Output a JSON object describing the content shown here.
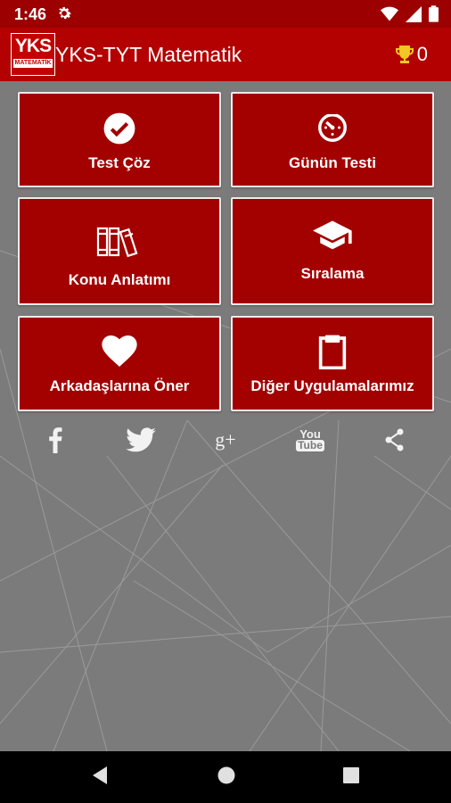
{
  "status_bar": {
    "time": "1:46",
    "icons": [
      "gear-icon",
      "wifi-icon",
      "signal-icon",
      "battery-icon"
    ]
  },
  "app_bar": {
    "logo": {
      "text": "YKS",
      "subtext": "MATEMATİK"
    },
    "title": "YKS-TYT Matematik",
    "trophy_count": "0"
  },
  "tiles": [
    {
      "label": "Test Çöz",
      "icon": "check-circle-icon"
    },
    {
      "label": "Günün Testi",
      "icon": "timer-icon"
    },
    {
      "label": "Konu Anlatımı",
      "icon": "books-icon"
    },
    {
      "label": "Sıralama",
      "icon": "graduation-cap-icon"
    },
    {
      "label": "Arkadaşlarına Öner",
      "icon": "heart-icon"
    },
    {
      "label": "Diğer Uygulamalarımız",
      "icon": "clipboard-icon"
    }
  ],
  "social": {
    "icons": [
      "facebook-icon",
      "twitter-icon",
      "google-plus-icon",
      "youtube-icon",
      "share-icon"
    ],
    "youtube_text_1": "You",
    "youtube_text_2": "Tube",
    "gplus_text": "g+"
  },
  "colors": {
    "primary": "#b30000",
    "status": "#9c0000",
    "tile": "#a30000",
    "background": "#7b7b7b"
  }
}
